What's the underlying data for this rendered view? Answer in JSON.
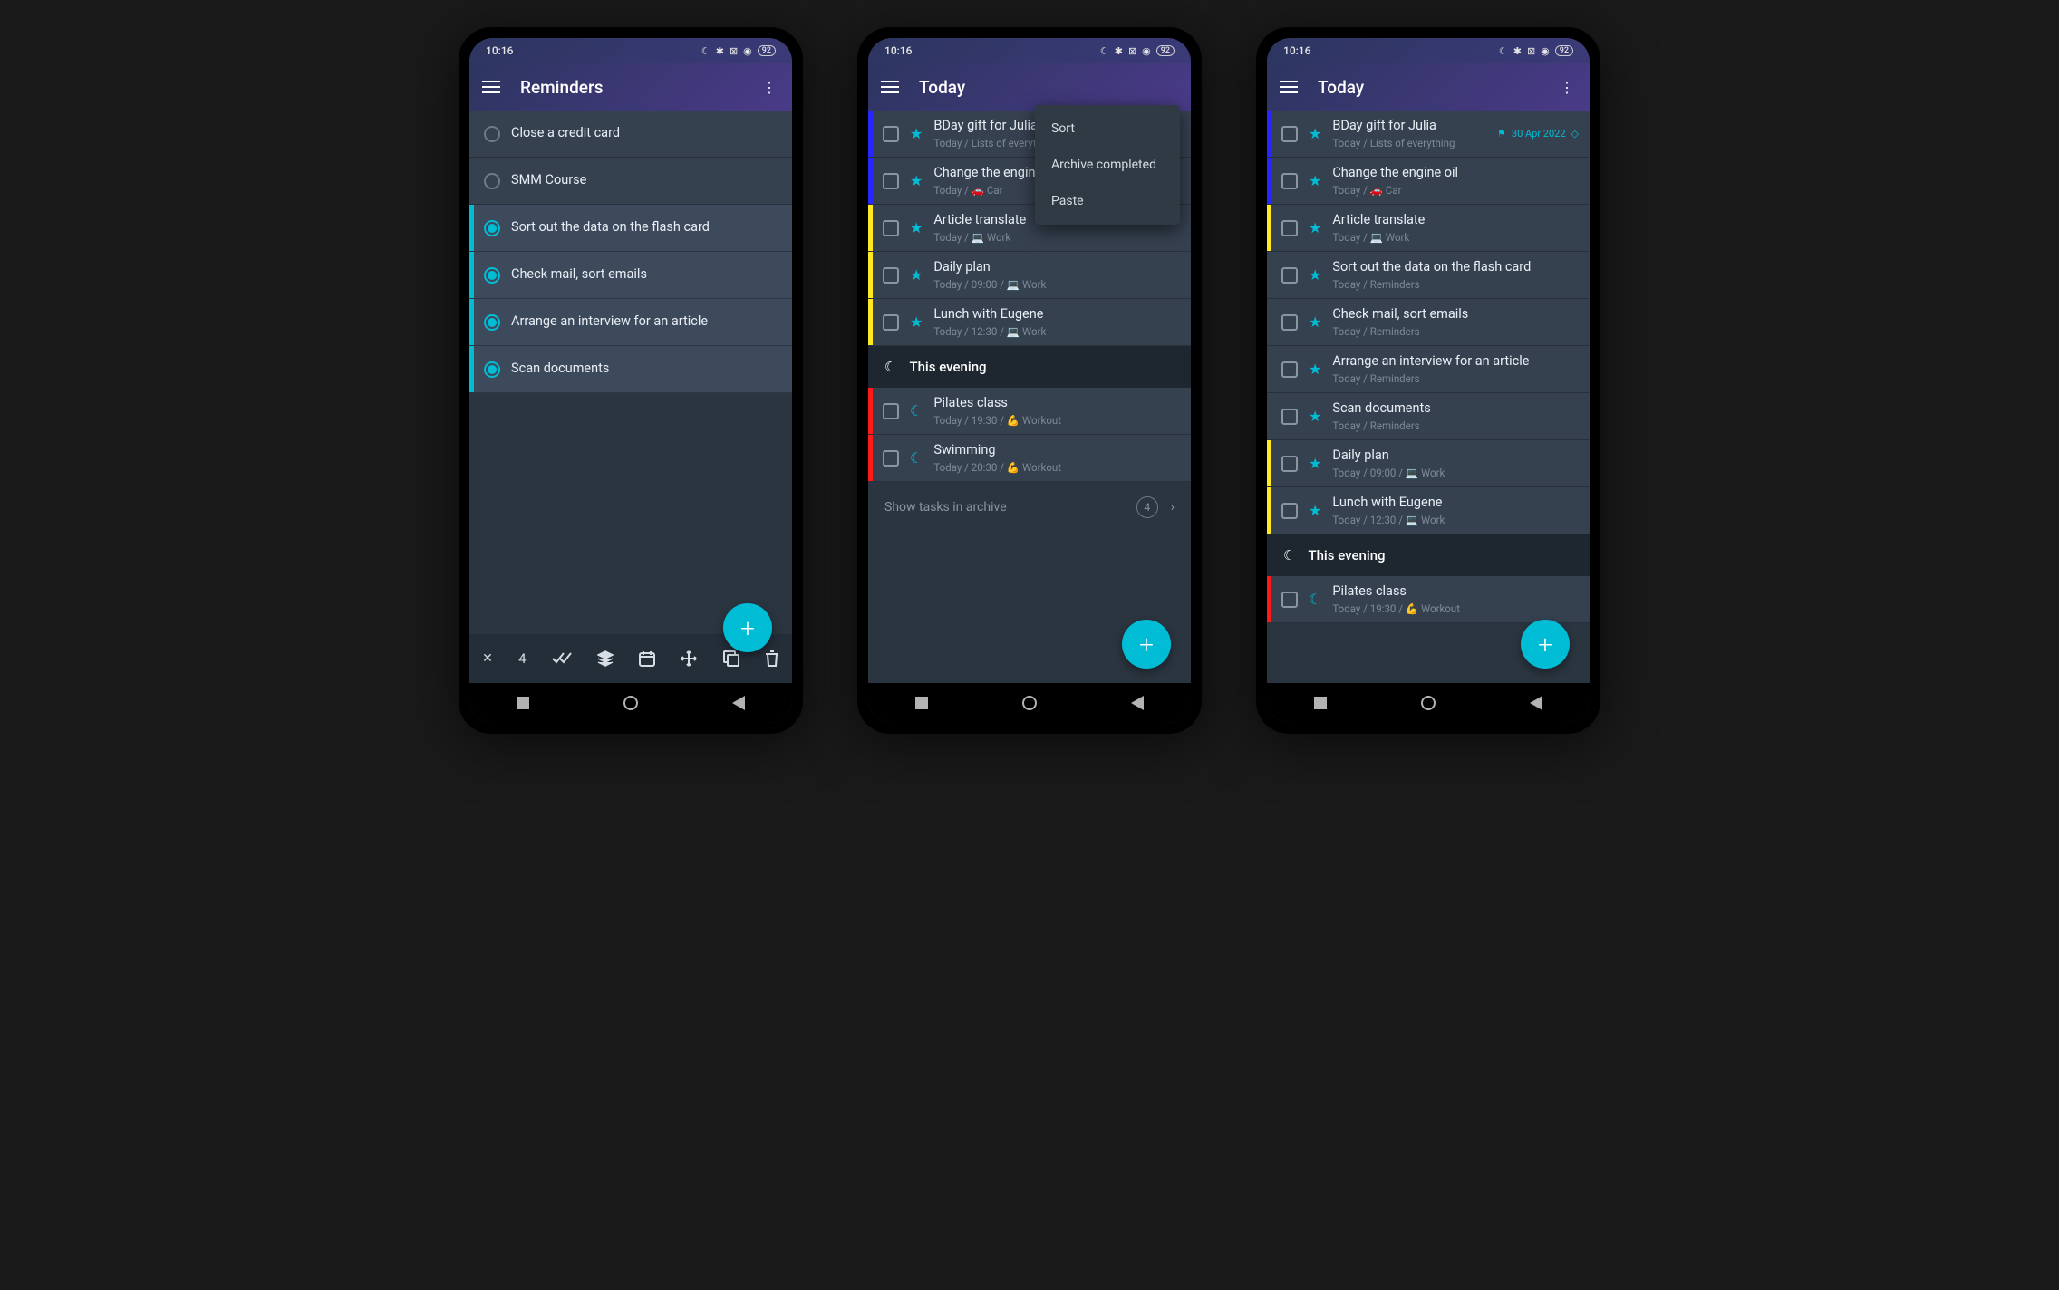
{
  "status": {
    "time": "10:16",
    "battery": "92"
  },
  "colors": {
    "accent": "#00bcd4"
  },
  "phone1": {
    "title": "Reminders",
    "tasks": [
      {
        "title": "Close a credit card",
        "selected": false
      },
      {
        "title": "SMM Course",
        "selected": false
      },
      {
        "title": "Sort out the data on the flash card",
        "selected": true
      },
      {
        "title": "Check mail, sort emails",
        "selected": true
      },
      {
        "title": "Arrange an interview for an article",
        "selected": true
      },
      {
        "title": "Scan documents",
        "selected": true
      }
    ],
    "selection_count": "4"
  },
  "phone2": {
    "title": "Today",
    "menu": [
      "Sort",
      "Archive completed",
      "Paste"
    ],
    "tasks": [
      {
        "title": "BDay gift for Julia",
        "sub": "Today / Lists of everything",
        "stripe": "blue",
        "star": true
      },
      {
        "title": "Change the engine oil",
        "sub": "Today / 🚗 Car",
        "stripe": "blue",
        "star": true
      },
      {
        "title": "Article translate",
        "sub": "Today / 💻 Work",
        "stripe": "yellow",
        "star": true
      },
      {
        "title": "Daily plan",
        "sub": "Today / 09:00 / 💻 Work",
        "stripe": "yellow",
        "star": true
      },
      {
        "title": "Lunch with Eugene",
        "sub": "Today / 12:30 / 💻 Work",
        "stripe": "yellow",
        "star": true
      }
    ],
    "section": "This evening",
    "evening": [
      {
        "title": "Pilates class",
        "sub": "Today / 19:30 / 💪 Workout",
        "stripe": "red"
      },
      {
        "title": "Swimming",
        "sub": "Today / 20:30 / 💪 Workout",
        "stripe": "red"
      }
    ],
    "archive_label": "Show tasks in archive",
    "archive_count": "4"
  },
  "phone3": {
    "title": "Today",
    "tasks": [
      {
        "title": "BDay gift for Julia",
        "sub": "Today / Lists of everything",
        "stripe": "blue",
        "star": true,
        "meta_date": "30 Apr 2022"
      },
      {
        "title": "Change the engine oil",
        "sub": "Today / 🚗 Car",
        "stripe": "blue",
        "star": true
      },
      {
        "title": "Article translate",
        "sub": "Today / 💻 Work",
        "stripe": "yellow",
        "star": true
      },
      {
        "title": "Sort out the data on the flash card",
        "sub": "Today / Reminders",
        "stripe": "",
        "star": true
      },
      {
        "title": "Check mail, sort emails",
        "sub": "Today / Reminders",
        "stripe": "",
        "star": true
      },
      {
        "title": "Arrange an interview for an article",
        "sub": "Today / Reminders",
        "stripe": "",
        "star": true
      },
      {
        "title": "Scan documents",
        "sub": "Today / Reminders",
        "stripe": "",
        "star": true
      },
      {
        "title": "Daily plan",
        "sub": "Today / 09:00 / 💻 Work",
        "stripe": "yellow",
        "star": true
      },
      {
        "title": "Lunch with Eugene",
        "sub": "Today / 12:30 / 💻 Work",
        "stripe": "yellow",
        "star": true
      }
    ],
    "section": "This evening",
    "evening": [
      {
        "title": "Pilates class",
        "sub": "Today / 19:30 / 💪 Workout",
        "stripe": "red"
      }
    ]
  }
}
